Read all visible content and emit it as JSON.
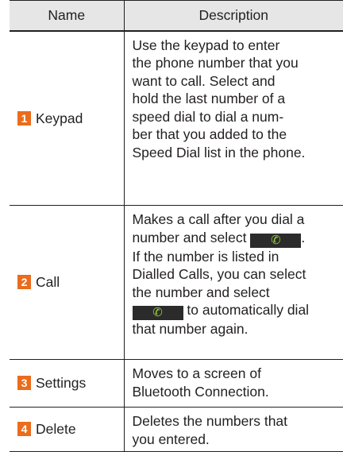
{
  "table": {
    "headers": {
      "name": "Name",
      "description": "Description"
    },
    "rows": [
      {
        "number": "1",
        "name": "Keypad",
        "description_lines": [
          "Use the keypad to enter",
          "the phone number that you",
          "want to call. Select and",
          "hold the last number of a",
          "speed dial to dial a num-",
          "ber that you added to the",
          "Speed Dial list in the phone."
        ]
      },
      {
        "number": "2",
        "name": "Call",
        "description_lines": [
          "Makes a call after you dial a",
          "number and select",
          ".",
          "If the number is listed in",
          "Dialled Calls, you can select",
          "the number and select",
          "to automatically dial",
          "that number again."
        ]
      },
      {
        "number": "3",
        "name": "Settings",
        "description_lines": [
          "Moves to a screen of",
          "Bluetooth Connection."
        ]
      },
      {
        "number": "4",
        "name": "Delete",
        "description_lines": [
          "Deletes the numbers that",
          "you entered."
        ]
      }
    ]
  },
  "icons": {
    "call_button_icon": "phone-handset-icon"
  },
  "colors": {
    "number_badge": "#ea6c1c",
    "call_button_bg": "#2b2b2b",
    "call_button_icon": "#9bd43a",
    "header_bg": "#e6e6e6"
  }
}
